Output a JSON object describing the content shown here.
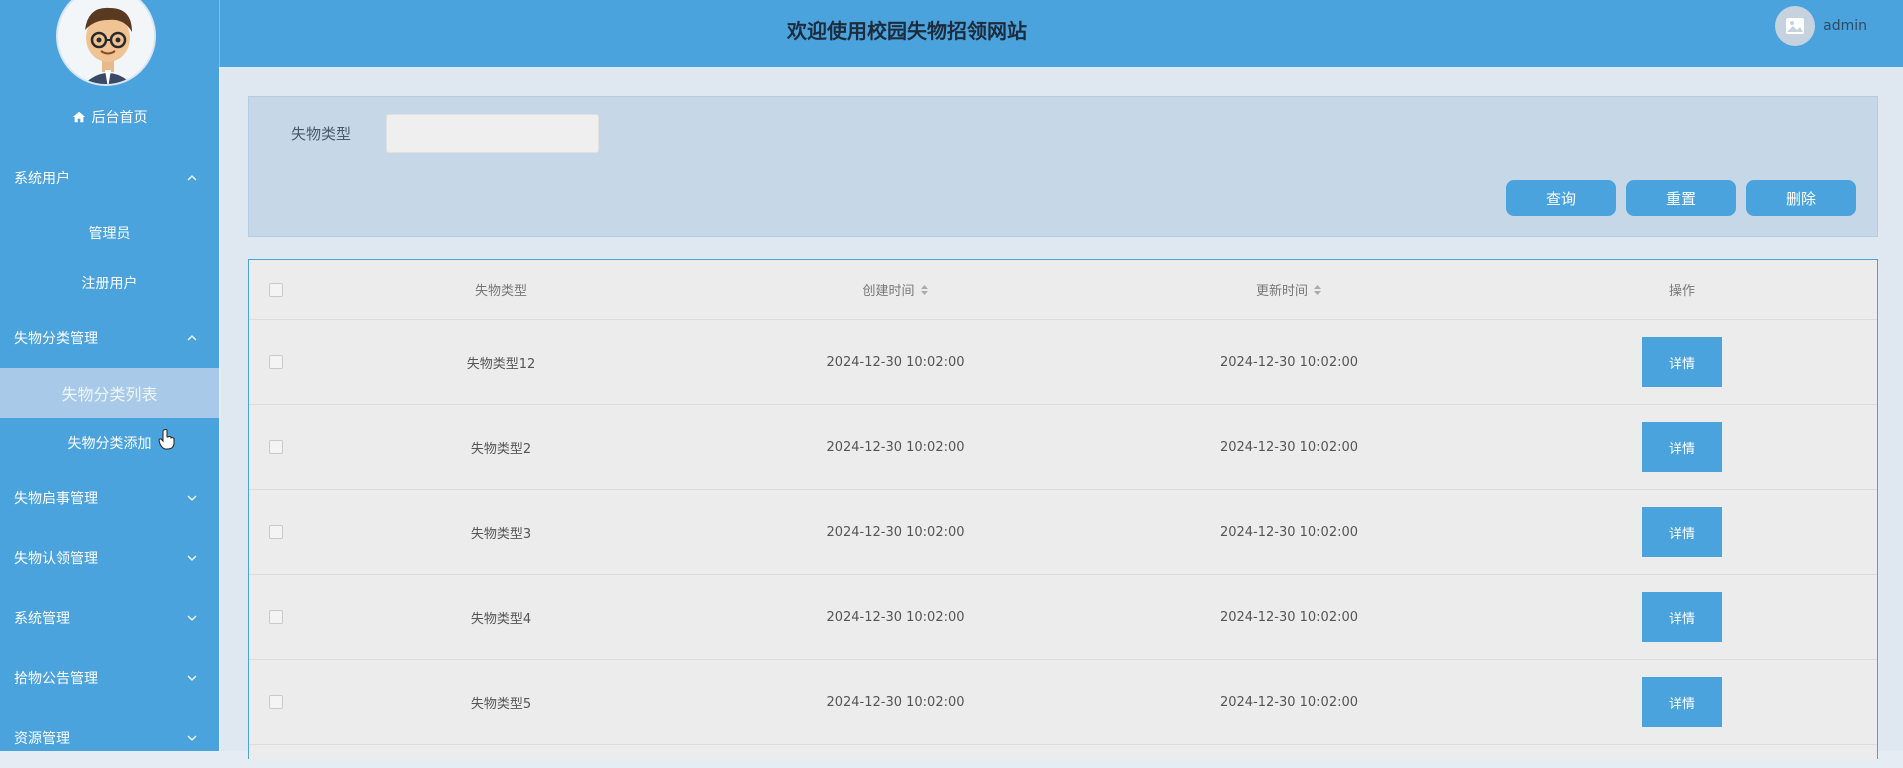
{
  "site_title": "欢迎使用校园失物招领网站",
  "user": {
    "name": "admin"
  },
  "sidebar": {
    "home_label": "后台首页",
    "menu": [
      {
        "label": "系统用户",
        "expanded": true,
        "children": [
          "管理员",
          "注册用户"
        ]
      },
      {
        "label": "失物分类管理",
        "expanded": true,
        "children": [
          "失物分类列表",
          "失物分类添加"
        ],
        "active_child": "失物分类列表"
      },
      {
        "label": "失物启事管理",
        "expanded": false
      },
      {
        "label": "失物认领管理",
        "expanded": false
      },
      {
        "label": "系统管理",
        "expanded": false
      },
      {
        "label": "拾物公告管理",
        "expanded": false
      },
      {
        "label": "资源管理",
        "expanded": false
      }
    ]
  },
  "search": {
    "label": "失物类型",
    "value": "",
    "buttons": {
      "query": "查询",
      "reset": "重置",
      "delete": "删除"
    }
  },
  "table": {
    "columns": [
      "失物类型",
      "创建时间",
      "更新时间",
      "操作"
    ],
    "rows": [
      {
        "type": "失物类型12",
        "created": "2024-12-30 10:02:00",
        "updated": "2024-12-30 10:02:00",
        "action": "详情"
      },
      {
        "type": "失物类型2",
        "created": "2024-12-30 10:02:00",
        "updated": "2024-12-30 10:02:00",
        "action": "详情"
      },
      {
        "type": "失物类型3",
        "created": "2024-12-30 10:02:00",
        "updated": "2024-12-30 10:02:00",
        "action": "详情"
      },
      {
        "type": "失物类型4",
        "created": "2024-12-30 10:02:00",
        "updated": "2024-12-30 10:02:00",
        "action": "详情"
      },
      {
        "type": "失物类型5",
        "created": "2024-12-30 10:02:00",
        "updated": "2024-12-30 10:02:00",
        "action": "详情"
      }
    ]
  },
  "colors": {
    "primary": "#4ba3dd",
    "active_menu": "#a8c9e7",
    "header_text": "#1d2c3d"
  },
  "icons": [
    "home-icon",
    "chevron-up-icon",
    "chevron-down-icon",
    "sort-icon",
    "image-placeholder-icon"
  ]
}
